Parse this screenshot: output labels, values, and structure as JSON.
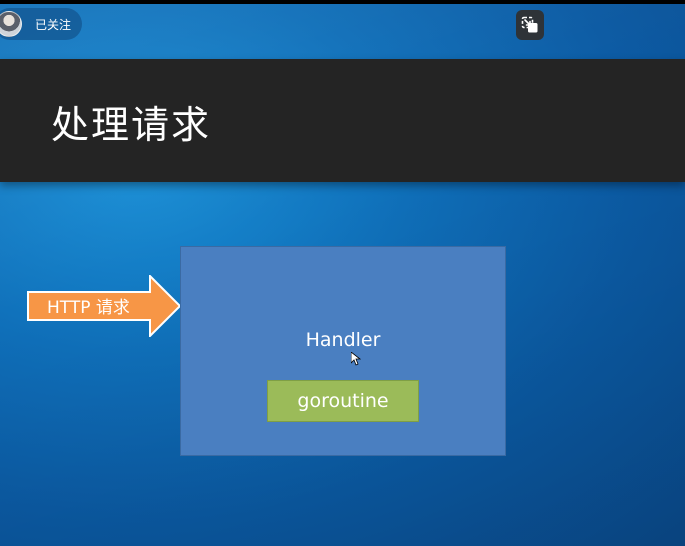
{
  "header": {
    "follow_label": "已关注",
    "avatar_icon": "user-avatar",
    "restore_icon": "exit-fullscreen-icon"
  },
  "slide": {
    "title": "处理请求",
    "arrow_label": "HTTP 请求",
    "handler_label": "Handler",
    "goroutine_label": "goroutine"
  },
  "colors": {
    "title_bar": "#242424",
    "handler_box": "#4a7fc1",
    "goroutine_box": "#9bbb59",
    "arrow": "#f79646",
    "background": "#0b5aa3"
  }
}
